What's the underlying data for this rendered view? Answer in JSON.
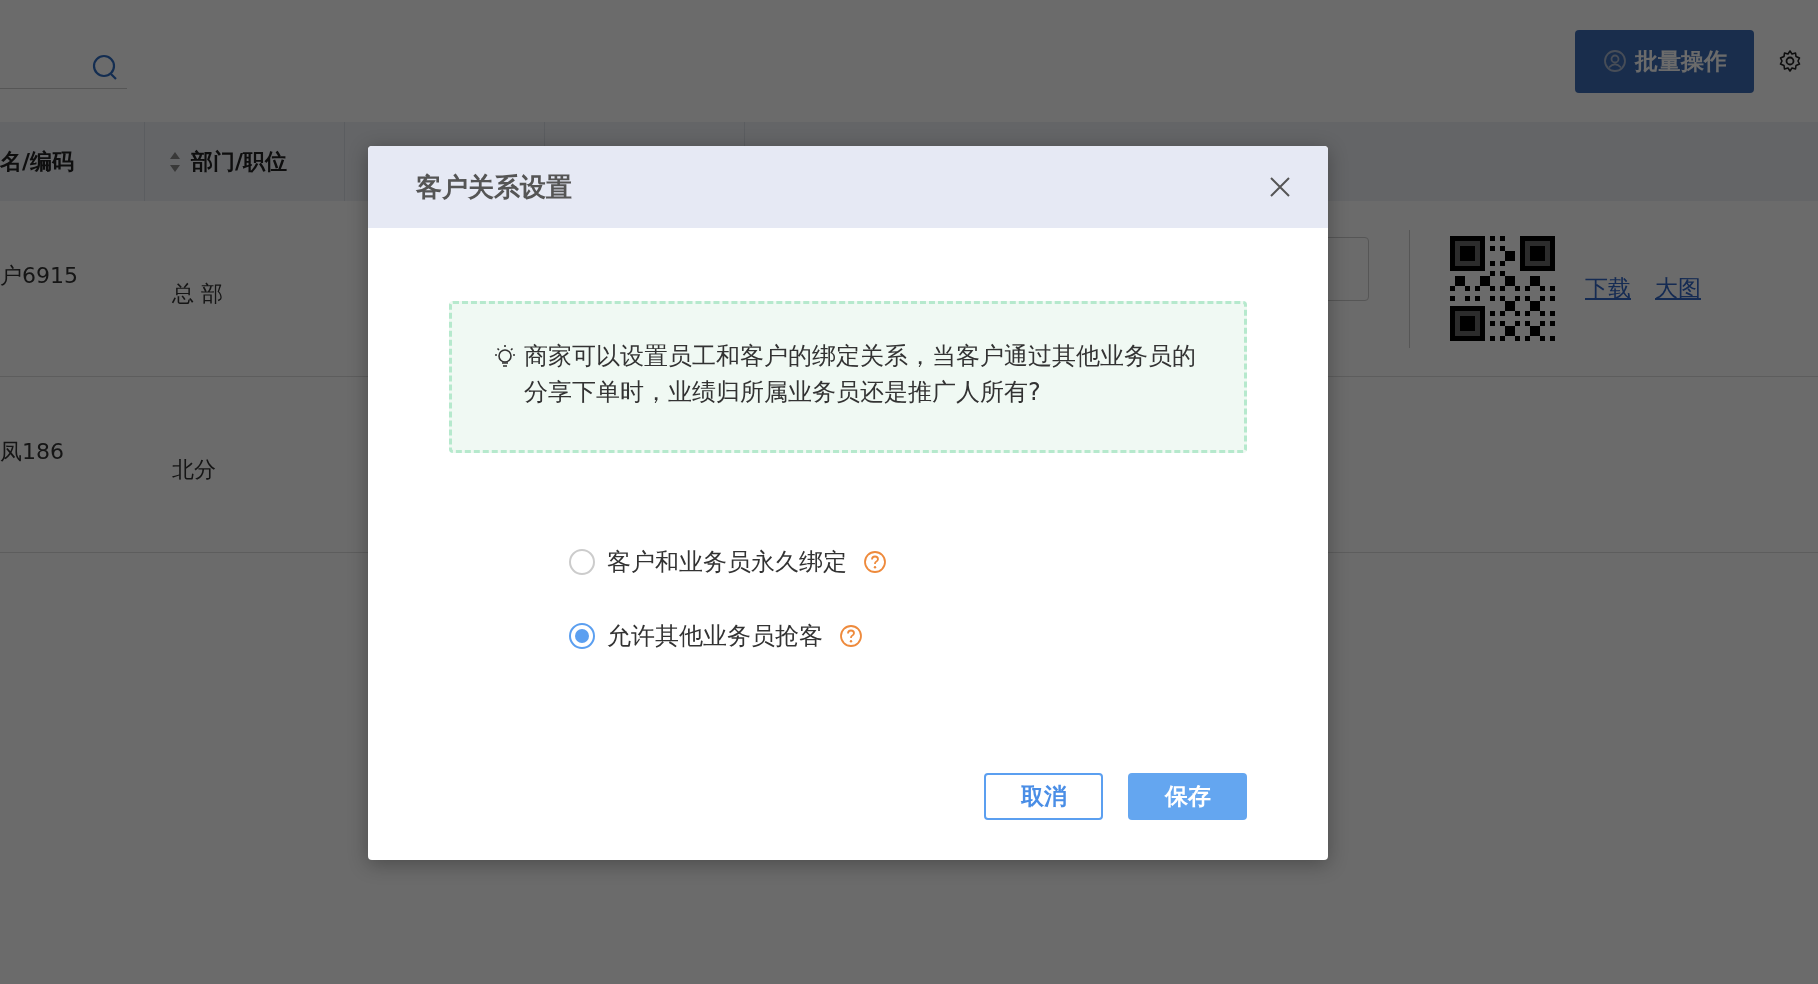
{
  "toolbar": {
    "batch_button": "批量操作"
  },
  "table": {
    "columns": [
      {
        "label": "名/编码",
        "sortable": false
      },
      {
        "label": "部门/职位",
        "sortable": true
      }
    ],
    "rows": [
      {
        "kind": "with_code",
        "cells": [
          "户6915",
          "总 部"
        ],
        "links": [
          "下载",
          "大图"
        ]
      },
      {
        "kind": "plain",
        "cells": [
          "凤186",
          "北分"
        ]
      }
    ]
  },
  "dialog": {
    "title": "客户关系设置",
    "tip": "商家可以设置员工和客户的绑定关系，当客户通过其他业务员的分享下单时，业绩归所属业务员还是推广人所有?",
    "options": [
      {
        "label": "客户和业务员永久绑定",
        "selected": false
      },
      {
        "label": "允许其他业务员抢客",
        "selected": true
      }
    ],
    "buttons": [
      {
        "label": "取消",
        "kind": "secondary"
      },
      {
        "label": "保存",
        "kind": "primary"
      }
    ]
  }
}
